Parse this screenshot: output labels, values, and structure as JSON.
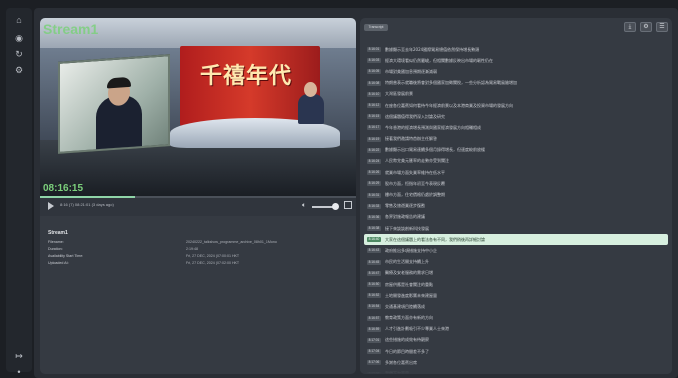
{
  "sidebar": {
    "icons": [
      "home-icon",
      "broadcast-icon",
      "history-icon",
      "settings-icon"
    ],
    "bottom_icons": [
      "logout-icon",
      "dot-icon"
    ]
  },
  "video": {
    "overlay_title": "Stream1",
    "timestamp": "08:16:15",
    "wall_text": "千禧年代",
    "progress_fraction": 0.3
  },
  "controls": {
    "time_text": "8:16 (7) 08:21:01 (3 days ago)"
  },
  "meta": {
    "title": "Stream1",
    "rows": [
      {
        "key": "Filename:",
        "value": "20240222_talkshow_programme_archive_08h01_1Mono"
      },
      {
        "key": "Duration:",
        "value": "2:19:48"
      },
      {
        "key": "Availability Start Time:",
        "value": "Fri, 27 DEC, 2024 (07:00:01 HKT"
      },
      {
        "key": "Uploaded At:",
        "value": "Fri, 27 DEC, 2024 (07:02:00 HKT"
      }
    ]
  },
  "transcript": {
    "tab_label": "Transcript",
    "buttons": [
      "download-icon",
      "settings-icon",
      "list-icon"
    ],
    "active_index": 17,
    "rows": [
      {
        "ts": "8:16:01",
        "text": "數據顯示至去年2024國際貿易總值依然保持增長勢頭"
      },
      {
        "ts": "8:16:03",
        "text": "經濟大環境看似仍然嚴峻，但相關數據反映出市場的韌性仍在"
      },
      {
        "ts": "8:16:05",
        "text": "市場對美國加息預期逐漸減弱"
      },
      {
        "ts": "8:16:08",
        "text": "特朗普表示就職後將會對多個國家加徵關稅，一些分析認為貿易戰風險增加"
      },
      {
        "ts": "8:16:10",
        "text": "大灣區發展前景"
      },
      {
        "ts": "8:16:12",
        "text": "在座各位嘉賓如何看待今年經濟前景以及本港商業及投資市場的發展方向"
      },
      {
        "ts": "8:16:15",
        "text": "這個議題值得我們深入討論及研究"
      },
      {
        "ts": "8:16:17",
        "text": "今年香港的經濟增長預測與國家經濟發展方向相輔相成"
      },
      {
        "ts": "8:16:19",
        "text": "接著我們邀請特首辦主任解答"
      },
      {
        "ts": "8:16:22",
        "text": "數據顯示出口貿易連續多個月錄得增長，但速度較前放緩"
      },
      {
        "ts": "8:16:24",
        "text": "人民幣兌美元匯率的走勢亦受到關注"
      },
      {
        "ts": "8:16:26",
        "text": "就業市場方面失業率維持在低水平"
      },
      {
        "ts": "8:16:29",
        "text": "股市方面，恒指年初至今表現反覆"
      },
      {
        "ts": "8:16:31",
        "text": "樓市方面，住宅價格仍處於調整期"
      },
      {
        "ts": "8:16:33",
        "text": "零售及旅遊業逐步復甦"
      },
      {
        "ts": "8:16:36",
        "text": "各界對施政報告的建議"
      },
      {
        "ts": "8:16:38",
        "text": "接下來談談創新科技發展"
      },
      {
        "ts": "8:16:40",
        "text": "大家在這個議題上的看法各有不同，我們稍後再詳細討論"
      },
      {
        "ts": "8:16:43",
        "text": "政府推出多項措施支持中小企"
      },
      {
        "ts": "8:16:45",
        "text": "市民的生活開支持續上升"
      },
      {
        "ts": "8:16:47",
        "text": "醫療及安老服務的需求日增"
      },
      {
        "ts": "8:16:50",
        "text": "房屋供應是社會關注的重點"
      },
      {
        "ts": "8:16:52",
        "text": "土地開發進度影響未來建屋量"
      },
      {
        "ts": "8:16:54",
        "text": "交通基建項目陸續落成"
      },
      {
        "ts": "8:16:57",
        "text": "教育政策方面亦有新的方向"
      },
      {
        "ts": "8:16:59",
        "text": "人才引進計劃吸引不少專業人士來港"
      },
      {
        "ts": "8:17:01",
        "text": "這些措施的成效有待觀察"
      },
      {
        "ts": "8:17:04",
        "text": "今日的節目時間差不多了"
      },
      {
        "ts": "8:17:06",
        "text": "多謝各位嘉賓出席"
      },
      {
        "ts": "8:17:08",
        "text": "我們下次再見"
      }
    ]
  }
}
